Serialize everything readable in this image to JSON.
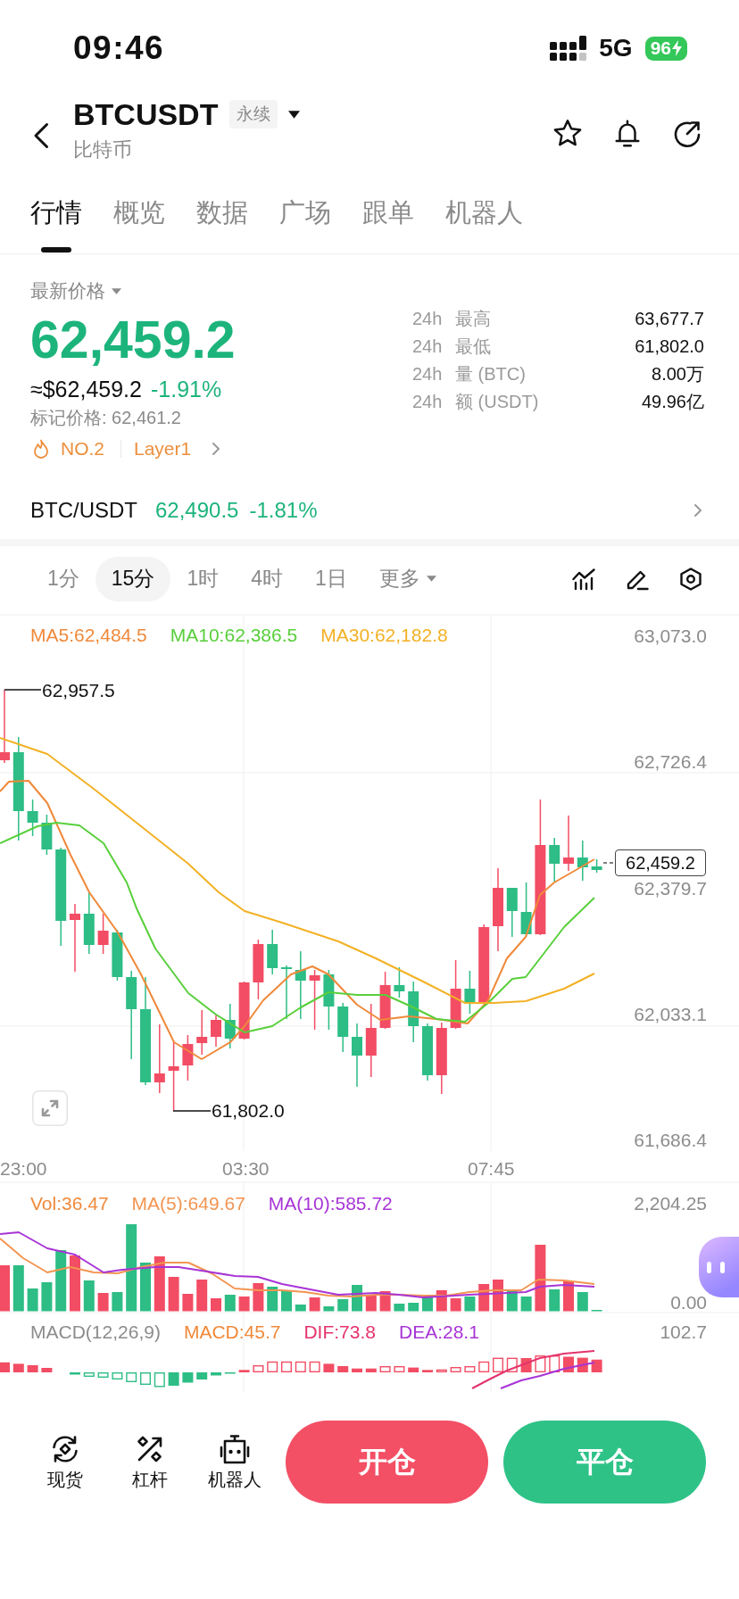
{
  "status_bar": {
    "time": "09:46",
    "network": "5G",
    "battery": "96"
  },
  "header": {
    "title": "BTCUSDT",
    "badge": "永续",
    "subtitle": "比特币"
  },
  "tabs": [
    {
      "label": "行情",
      "selected": true
    },
    {
      "label": "概览",
      "selected": false
    },
    {
      "label": "数据",
      "selected": false
    },
    {
      "label": "广场",
      "selected": false
    },
    {
      "label": "跟单",
      "selected": false
    },
    {
      "label": "机器人",
      "selected": false
    }
  ],
  "price": {
    "label": "最新价格",
    "last": "62,459.2",
    "fiat": "≈$62,459.2",
    "change": "-1.91%",
    "mark_price": "标记价格: 62,461.2",
    "rank": "NO.2",
    "sector": "Layer1"
  },
  "stats": [
    {
      "period": "24h",
      "label": "最高",
      "value": "63,677.7"
    },
    {
      "period": "24h",
      "label": "最低",
      "value": "61,802.0"
    },
    {
      "period": "24h",
      "label": "量 (BTC)",
      "value": "8.00万"
    },
    {
      "period": "24h",
      "label": "额 (USDT)",
      "value": "49.96亿"
    }
  ],
  "spot_pair": {
    "name": "BTC/USDT",
    "price": "62,490.5",
    "change": "-1.81%"
  },
  "intervals": [
    {
      "label": "1分",
      "selected": false
    },
    {
      "label": "15分",
      "selected": true
    },
    {
      "label": "1时",
      "selected": false
    },
    {
      "label": "4时",
      "selected": false
    },
    {
      "label": "1日",
      "selected": false
    }
  ],
  "more": {
    "label": "更多"
  },
  "chart": {
    "ma_legend": [
      {
        "text": "MA5:62,484.5",
        "color": "#f0893a"
      },
      {
        "text": "MA10:62,386.5",
        "color": "#58cf3b"
      },
      {
        "text": "MA30:62,182.8",
        "color": "#f2b125"
      }
    ],
    "price_axis": [
      "63,073.0",
      "62,726.4",
      "62,379.7",
      "62,033.1",
      "61,686.4"
    ],
    "time_axis": [
      "23:00",
      "03:30",
      "07:45"
    ],
    "high_marker": "62,957.5",
    "low_marker": "61,802.0",
    "last_price_tag": "62,459.2",
    "volume_legend": [
      {
        "text": "Vol:36.47",
        "color": "#f0893a"
      },
      {
        "text": "MA(5):649.67",
        "color": "#f29552"
      },
      {
        "text": "MA(10):585.72",
        "color": "#a834d6"
      }
    ],
    "volume_axis": [
      "2,204.25",
      "0.00"
    ],
    "macd_legend": [
      {
        "text": "MACD(12,26,9)",
        "color": "#8c8c8c"
      },
      {
        "text": "MACD:45.7",
        "color": "#f0893a"
      },
      {
        "text": "DIF:73.8",
        "color": "#e5336c"
      },
      {
        "text": "DEA:28.1",
        "color": "#a834d6"
      }
    ],
    "macd_axis": [
      "102.7"
    ]
  },
  "bottom_nav": [
    {
      "label": "现货"
    },
    {
      "label": "杠杆"
    },
    {
      "label": "机器人"
    }
  ],
  "actions": [
    {
      "label": "开仓"
    },
    {
      "label": "平仓"
    }
  ]
}
